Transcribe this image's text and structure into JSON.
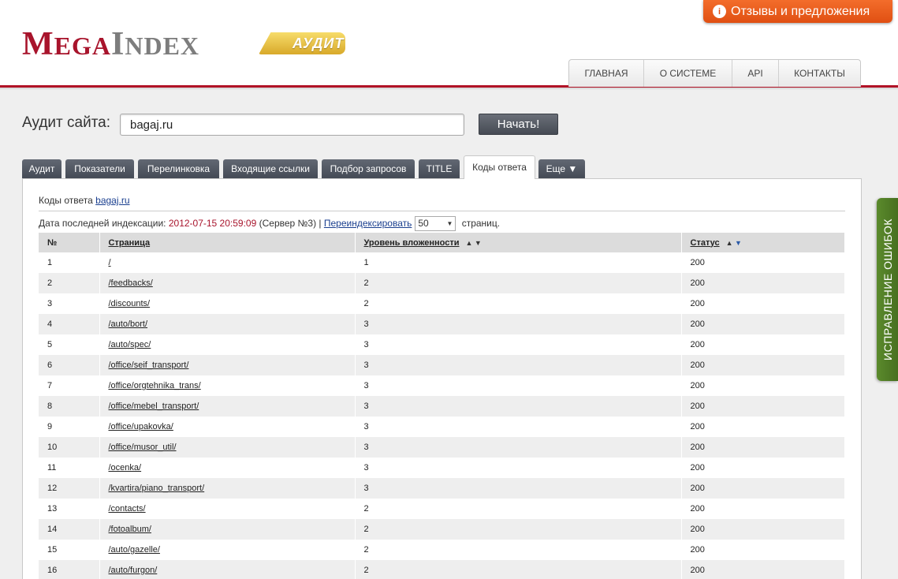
{
  "feedback": {
    "icon": "lightbulb-icon",
    "label": "Отзывы и предложения"
  },
  "logo": {
    "part1_first": "M",
    "part1_rest": "EGA",
    "part2_first": "I",
    "part2_rest": "NDEX",
    "badge": "АУДИТ"
  },
  "top_nav": [
    "ГЛАВНАЯ",
    "О СИСТЕМЕ",
    "API",
    "КОНТАКТЫ"
  ],
  "search": {
    "label": "Аудит сайта:",
    "value": "bagaj.ru",
    "button": "Начать!"
  },
  "tabs": [
    {
      "label": "Аудит",
      "active": false
    },
    {
      "label": "Показатели",
      "active": false
    },
    {
      "label": "Перелинковка",
      "active": false
    },
    {
      "label": "Входящие ссылки",
      "active": false
    },
    {
      "label": "Подбор запросов",
      "active": false
    },
    {
      "label": "TITLE",
      "active": false
    },
    {
      "label": "Коды ответа",
      "active": true
    },
    {
      "label": "Еще ▼",
      "active": false
    }
  ],
  "panel": {
    "title_prefix": "Коды ответа ",
    "title_link": "bagaj.ru",
    "index_label": "Дата последней индексации: ",
    "index_date": "2012-07-15 20:59:09",
    "server": " (Сервер №3) | ",
    "reindex_link": "Переиндексировать",
    "per_page": "50",
    "per_page_suffix": " страниц."
  },
  "table": {
    "headers": {
      "num": "№",
      "page": "Страница",
      "depth": "Уровень вложенности",
      "status": "Статус"
    },
    "rows": [
      {
        "num": "1",
        "page": "/",
        "depth": "1",
        "status": "200"
      },
      {
        "num": "2",
        "page": "/feedbacks/",
        "depth": "2",
        "status": "200"
      },
      {
        "num": "3",
        "page": "/discounts/",
        "depth": "2",
        "status": "200"
      },
      {
        "num": "4",
        "page": "/auto/bort/",
        "depth": "3",
        "status": "200"
      },
      {
        "num": "5",
        "page": "/auto/spec/",
        "depth": "3",
        "status": "200"
      },
      {
        "num": "6",
        "page": "/office/seif_transport/",
        "depth": "3",
        "status": "200"
      },
      {
        "num": "7",
        "page": "/office/orgtehnika_trans/",
        "depth": "3",
        "status": "200"
      },
      {
        "num": "8",
        "page": "/office/mebel_transport/",
        "depth": "3",
        "status": "200"
      },
      {
        "num": "9",
        "page": "/office/upakovka/",
        "depth": "3",
        "status": "200"
      },
      {
        "num": "10",
        "page": "/office/musor_util/",
        "depth": "3",
        "status": "200"
      },
      {
        "num": "11",
        "page": "/ocenka/",
        "depth": "3",
        "status": "200"
      },
      {
        "num": "12",
        "page": "/kvartira/piano_transport/",
        "depth": "3",
        "status": "200"
      },
      {
        "num": "13",
        "page": "/contacts/",
        "depth": "2",
        "status": "200"
      },
      {
        "num": "14",
        "page": "/fotoalbum/",
        "depth": "2",
        "status": "200"
      },
      {
        "num": "15",
        "page": "/auto/gazelle/",
        "depth": "2",
        "status": "200"
      },
      {
        "num": "16",
        "page": "/auto/furgon/",
        "depth": "2",
        "status": "200"
      }
    ]
  },
  "side_tab": "ИСПРАВЛЕНИЕ ОШИБОК",
  "colors": {
    "brand_red": "#a8142c",
    "accent_orange": "#e04f12",
    "side_green": "#4f7a24",
    "tab_dark": "#4f5560"
  }
}
